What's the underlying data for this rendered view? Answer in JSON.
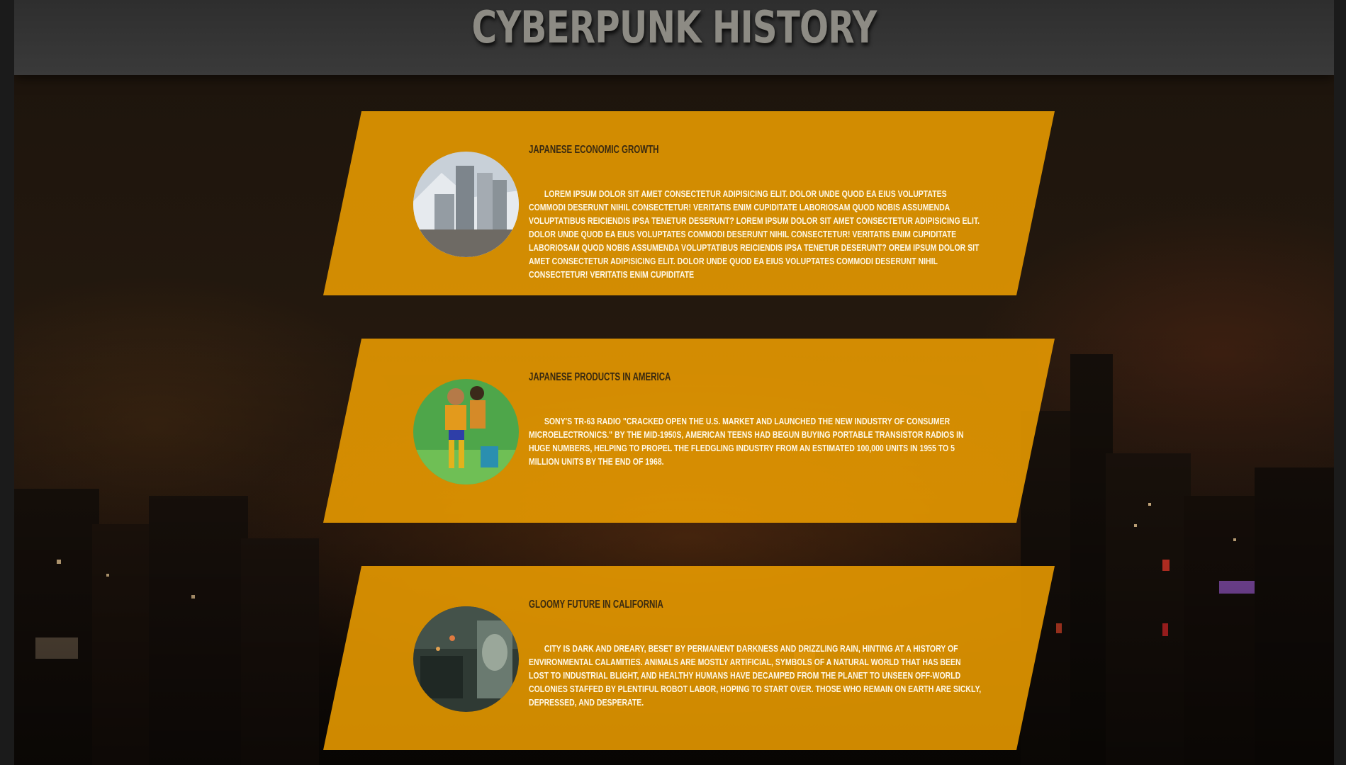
{
  "header": {
    "title": "CYBERPUNK HISTORY"
  },
  "cards": [
    {
      "title": "JAPANESE ECONOMIC GROWTH",
      "text": "Lorem ipsum dolor sit amet consectetur adipisicing elit. Dolor unde quod ea eius voluptates commodi deserunt nihil consectetur! Veritatis enim cupiditate laboriosam quod nobis assumenda voluptatibus reiciendis ipsa tenetur deserunt? Lorem ipsum dolor sit amet consectetur adipisicing elit. Dolor unde quod ea eius voluptates commodi deserunt nihil consectetur! Veritatis enim cupiditate laboriosam quod nobis assumenda voluptatibus reiciendis ipsa tenetur deserunt? orem ipsum dolor sit amet consectetur adipisicing elit. Dolor unde quod ea eius voluptates commodi deserunt nihil consectetur! Veritatis enim cupiditate",
      "image_icon": "tokyo-skyline-photo"
    },
    {
      "title": "JAPANESE PRODUCTS IN AMERICA",
      "text": "Sony's TR-63 radio \"cracked open the U.S. market and launched the new industry of consumer microelectronics.\" By the mid-1950s, American teens had begun buying portable transistor radios in huge numbers, helping to propel the fledgling industry from an estimated 100,000 units in 1955 to 5 million units by the end of 1968.",
      "image_icon": "roller-skater-radio-photo"
    },
    {
      "title": "GLOOMY FUTURE IN CALIFORNIA",
      "text": "City is dark and dreary, beset by permanent darkness and drizzling rain, hinting at a history of environmental calamities. Animals are mostly artificial, symbols of a natural world that has been lost to industrial blight, and healthy humans have decamped from the planet to unseen off-world colonies staffed by plentiful robot labor, hoping to start over. Those who remain on Earth are sickly, depressed, and desperate.",
      "image_icon": "blade-runner-city-photo"
    }
  ],
  "colors": {
    "card": "#f0a000",
    "header": "#343434",
    "title": "#8d8b84"
  }
}
